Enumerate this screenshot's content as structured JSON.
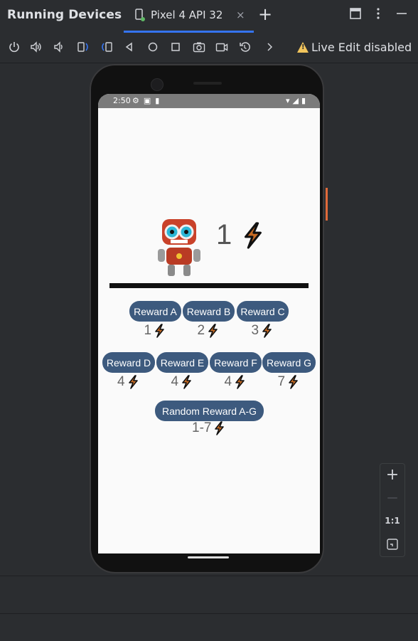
{
  "app": {
    "title": "Running Devices"
  },
  "tab": {
    "label": "Pixel 4 API 32",
    "close": "×"
  },
  "toolbar": {
    "live_edit": "Live Edit disabled"
  },
  "icons": {
    "power": "power-icon",
    "vol_up": "volume-up-icon",
    "vol_down": "volume-down-icon",
    "rotate_left": "rotate-left-icon",
    "rotate_right": "rotate-right-icon",
    "back": "back-icon",
    "home": "home-icon",
    "overview": "overview-icon",
    "screenshot": "camera-icon",
    "record": "video-icon",
    "reset": "reset-icon",
    "more": "chevron-right-icon"
  },
  "device": {
    "status": {
      "time": "2:50"
    },
    "score": "1",
    "rewards_row1": [
      {
        "label": "Reward A",
        "cost": "1"
      },
      {
        "label": "Reward B",
        "cost": "2"
      },
      {
        "label": "Reward C",
        "cost": "3"
      }
    ],
    "rewards_row2": [
      {
        "label": "Reward D",
        "cost": "4"
      },
      {
        "label": "Reward E",
        "cost": "4"
      },
      {
        "label": "Reward F",
        "cost": "4"
      },
      {
        "label": "Reward G",
        "cost": "7"
      }
    ],
    "random": {
      "label": "Random Reward A-G",
      "cost": "1-7"
    }
  },
  "zoom": {
    "in": "+",
    "out": "—",
    "actual": "1:1"
  },
  "colors": {
    "accent": "#3574f0",
    "button": "#3d5a7e",
    "warning": "#f2c55c",
    "bolt": "#c76b24"
  }
}
